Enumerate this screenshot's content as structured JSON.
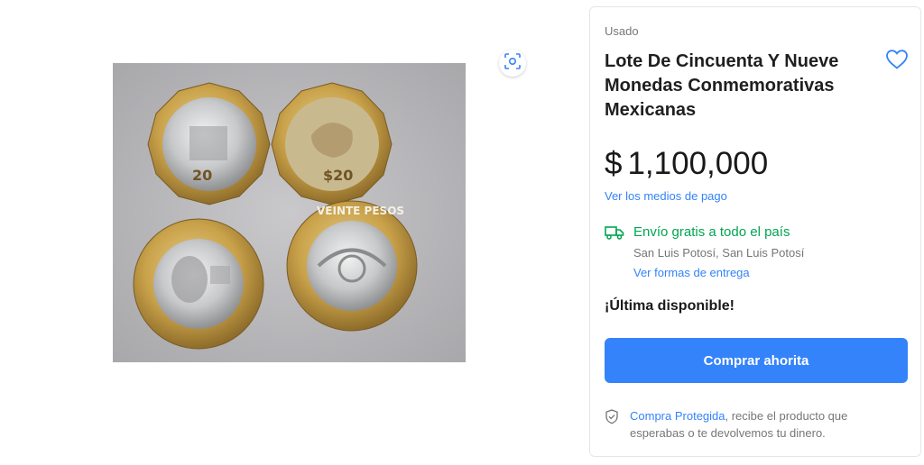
{
  "gallery": {
    "zoom_icon": "zoom-scan-icon",
    "main_image": "Four Mexican bimetallic commemorative coins: two 20-peso dodecagonal coins and two round 20-peso coins"
  },
  "product": {
    "condition": "Usado",
    "title": "Lote De Cincuenta Y Nueve Monedas Conmemorativas Mexicanas",
    "favorite_icon": "heart-outline-icon",
    "price_currency": "$",
    "price_value": "1,100,000",
    "payment_link": "Ver los medios de pago"
  },
  "shipping": {
    "icon": "truck-icon",
    "title": "Envío gratis a todo el país",
    "location": "San Luis Potosí, San Luis Potosí",
    "delivery_link": "Ver formas de entrega"
  },
  "stock": {
    "label": "¡Última disponible!"
  },
  "actions": {
    "buy_label": "Comprar ahorita"
  },
  "protection": {
    "icon": "shield-check-icon",
    "link": "Compra Protegida",
    "text": ", recibe el producto que esperabas o te devolvemos tu dinero."
  },
  "colors": {
    "accent": "#3483fa",
    "success": "#00a650",
    "gold": "#c9a24a",
    "silver": "#c9cbcd"
  }
}
